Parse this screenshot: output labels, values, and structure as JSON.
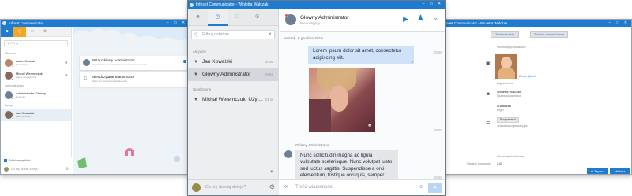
{
  "left_window": {
    "title": "Infoset Communicator",
    "window_controls": [
      "–",
      "□",
      "✕"
    ],
    "search_placeholder": "Filtruj",
    "groups": [
      {
        "label": "Ulubione",
        "items": [
          {
            "name": "Adam Nowak",
            "sub": "Niedostępny",
            "status_color": "#f0a020"
          },
          {
            "name": "Michał Weremczuk",
            "sub": "Zajęty wewnętrznie",
            "status_color": "#e14b4b"
          }
        ]
      },
      {
        "label": "Administratorzy",
        "items": [
          {
            "name": "Administrator Główny",
            "sub": "Dostępny",
            "status_color": "#3bb54a"
          }
        ]
      },
      {
        "label": "Zarząd",
        "items": [
          {
            "name": "Jan Kowalski",
            "sub": "Zaraz wracam",
            "status_color": "#f0a020"
          }
        ]
      }
    ],
    "show_all_label": "Pokaż wszystkich",
    "status_placeholder": "Co się dzisiaj dzieje?",
    "cards": [
      {
        "title": "Witaj Główny Administrator",
        "text": "zapraszamy do korzystania z Infoset Communicator"
      },
      {
        "title": "Nieodczytane wiadomości",
        "text": "Masz 1 nieodczytaną wiadomość"
      }
    ]
  },
  "right_window": {
    "title": "Infoset Communicator - Wioletta Walczak",
    "window_controls": [
      "–",
      "□",
      "✕"
    ],
    "tabs_left": [
      "Info",
      "Grupy"
    ],
    "buttons": [
      "Zmiana hasła",
      "Zmiana danych konta"
    ],
    "basic_info_label": "Informacje podstawowe",
    "photo_label": "Zdjęcie konta",
    "change_photo": "Zmień | Usuń",
    "name_value": "Wioletta Walczak",
    "name_label": "Nazwa wyświetlana",
    "login_value": "w.walczak",
    "login_label": "Login",
    "group_value": "Programiści",
    "group_label": "Jednostka organizacyjna",
    "extra_label": "Informacje dodatkowe",
    "last_login_label": "Ostatnie logowanie",
    "last_login_value": "2:47",
    "save_button": "Zapisz",
    "close_button": "Wstecz"
  },
  "center_window": {
    "title": "Infoset Communicator - Wioletta Walczak",
    "window_controls": [
      "–",
      "□",
      "✕"
    ],
    "search_placeholder": "Filtruj ostatnie",
    "group_active": "Aktywne",
    "group_inactive": "Nieaktywne",
    "conversations": [
      {
        "name": "Jan Kowalski",
        "time": "teraz",
        "selected": false
      },
      {
        "name": "Główny Administrator",
        "time": "09:55",
        "selected": true
      },
      {
        "name": "Michał Weremczuk, Użyt...",
        "time": "23 lis",
        "selected": false
      }
    ],
    "status_placeholder": "Co się dzisiaj dzieje?",
    "chat_name": "Główny Administrator",
    "chat_status": "Niedostępny",
    "date_label": "wtorek, 6 grudnia 2016",
    "msg1": "Lorem ipsum dolor sit amet, consectetur adipiscing elit.",
    "msg1_time": "09:55",
    "img_time": "09:55",
    "sender_label": "Główny Administrator",
    "msg2": "Nunc sollicitudin magna ac ligula vulputate scelerisque. Nunc volutpat justo sed luctus sagittis. Suspendisse a orci elementum, tristique orci quis, semper lacus.",
    "msg2_time": "09:55",
    "input_placeholder": "Treść wiadomości"
  }
}
